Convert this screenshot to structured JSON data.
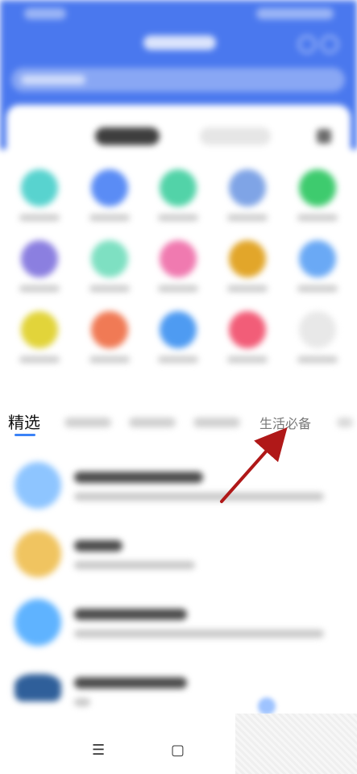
{
  "tabs": {
    "selected_label": "精选",
    "highlighted_label": "生活必备"
  },
  "nav": {
    "menu_glyph": "☰",
    "home_glyph": "▢"
  },
  "colors": {
    "header": "#4a78ee",
    "accent": "#3b82f6",
    "arrow": "#b01818"
  },
  "apps": [
    {
      "color": "#58d3cf"
    },
    {
      "color": "#5a8cf5"
    },
    {
      "color": "#52d3a8"
    },
    {
      "color": "#7fa4e6"
    },
    {
      "color": "#3ecb6e"
    },
    {
      "color": "#8b7fe0"
    },
    {
      "color": "#7ee0c2"
    },
    {
      "color": "#f07ab0"
    },
    {
      "color": "#e2a62a"
    },
    {
      "color": "#6aa9f5"
    },
    {
      "color": "#e2d43a"
    },
    {
      "color": "#f07a55"
    },
    {
      "color": "#4e9bf2"
    },
    {
      "color": "#f25d78"
    },
    {
      "color": "#e8e8e8"
    }
  ],
  "list_icons": [
    {
      "color": "#8ec5ff"
    },
    {
      "color": "#f0c460"
    },
    {
      "color": "#5fb3ff"
    },
    {
      "color": "#2f5f9a"
    }
  ]
}
